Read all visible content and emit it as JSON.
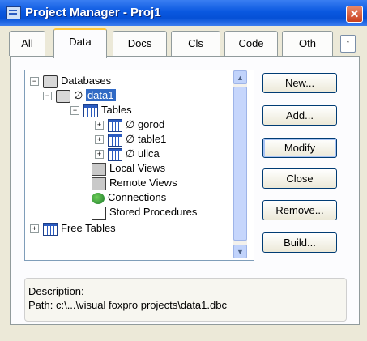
{
  "window": {
    "title": "Project Manager - Proj1",
    "close_glyph": "✕"
  },
  "tabs": [
    {
      "label": "All"
    },
    {
      "label": "Data"
    },
    {
      "label": "Docs"
    },
    {
      "label": "Cls"
    },
    {
      "label": "Code"
    },
    {
      "label": "Oth"
    }
  ],
  "tab_scroll_glyph": "↑",
  "tree": {
    "items": [
      {
        "label": "Databases",
        "icon": "database-icon",
        "expanded": true
      },
      {
        "label": "data1",
        "prefix": "∅",
        "icon": "database-icon",
        "selected": true,
        "expanded": true
      },
      {
        "label": "Tables",
        "icon": "table-icon",
        "expanded": true
      },
      {
        "label": "gorod",
        "prefix": "∅",
        "icon": "table-icon",
        "expanded": false
      },
      {
        "label": "table1",
        "prefix": "∅",
        "icon": "table-icon",
        "expanded": false
      },
      {
        "label": "ulica",
        "prefix": "∅",
        "icon": "table-icon",
        "expanded": false
      },
      {
        "label": "Local Views",
        "icon": "local-view-icon"
      },
      {
        "label": "Remote Views",
        "icon": "remote-view-icon"
      },
      {
        "label": "Connections",
        "icon": "connection-icon"
      },
      {
        "label": "Stored Procedures",
        "icon": "stored-procedure-icon"
      },
      {
        "label": "Free Tables",
        "icon": "table-icon",
        "expanded": false
      }
    ]
  },
  "buttons": {
    "new": "New...",
    "add": "Add...",
    "modify": "Modify",
    "close": "Close",
    "remove": "Remove...",
    "build": "Build..."
  },
  "description": {
    "label": "Description:",
    "path": "Path: c:\\...\\visual foxpro projects\\data1.dbc"
  }
}
